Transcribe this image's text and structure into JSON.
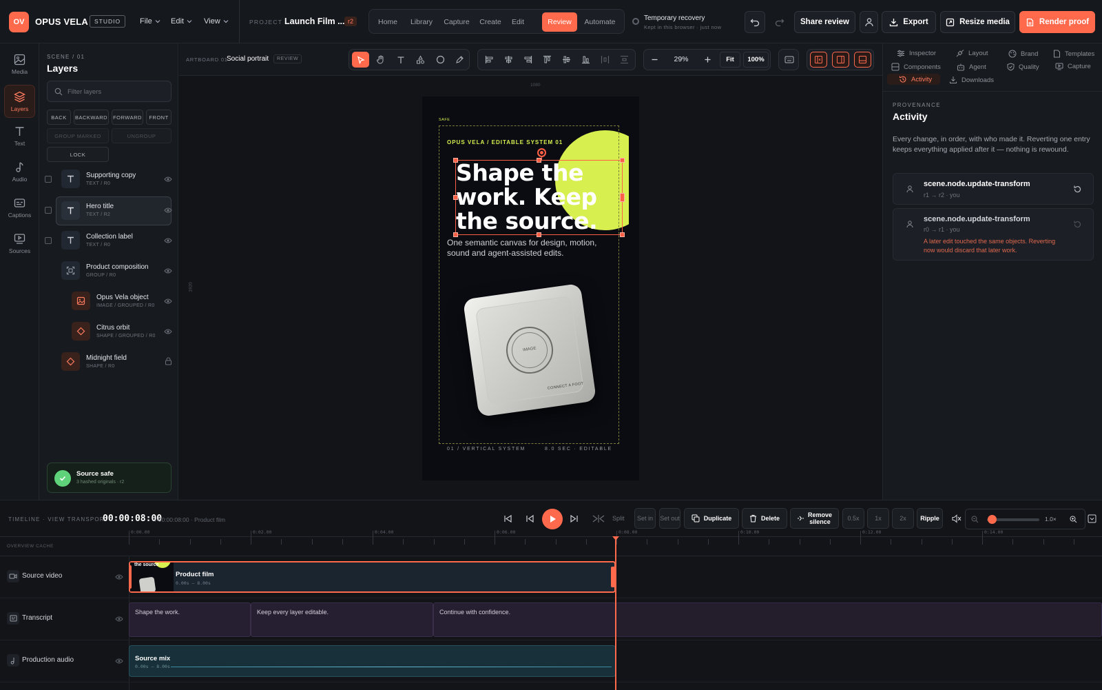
{
  "topbar": {
    "logo": "OV",
    "brand": "OPUS VELA",
    "studio": "STUDIO",
    "menus": [
      "File",
      "Edit",
      "View"
    ],
    "project_label": "PROJECT",
    "project_name": "Launch Film ...",
    "revision": "r2",
    "nav": [
      "Home",
      "Library",
      "Capture",
      "Create",
      "Edit",
      "Review",
      "Automate"
    ],
    "nav_active": "Review",
    "recovery_title": "Temporary recovery",
    "recovery_sub": "Kept in this browser · just now",
    "share": "Share review",
    "export": "Export",
    "resize": "Resize media",
    "render": "Render proof",
    "accent": "#ff6a4d"
  },
  "rail": [
    {
      "label": "Media",
      "icon": "image-icon"
    },
    {
      "label": "Layers",
      "icon": "layers-icon"
    },
    {
      "label": "Text",
      "icon": "text-icon"
    },
    {
      "label": "Audio",
      "icon": "music-note-icon"
    },
    {
      "label": "Captions",
      "icon": "captions-icon"
    },
    {
      "label": "Sources",
      "icon": "sources-icon"
    }
  ],
  "layers_panel": {
    "scene_label": "SCENE / 01",
    "title": "Layers",
    "filter_placeholder": "Filter layers",
    "order_buttons": [
      "BACK",
      "BACKWARD",
      "FORWARD",
      "FRONT"
    ],
    "group_buttons": [
      "GROUP MARKED",
      "UNGROUP"
    ],
    "lock_button": "LOCK",
    "items": [
      {
        "name": "Supporting copy",
        "sub": "TEXT / R0",
        "kind": "text"
      },
      {
        "name": "Hero title",
        "sub": "TEXT / R2",
        "kind": "text"
      },
      {
        "name": "Collection label",
        "sub": "TEXT / R0",
        "kind": "text"
      },
      {
        "name": "Product composition",
        "sub": "GROUP / R0",
        "kind": "group"
      },
      {
        "name": "Opus Vela object",
        "sub": "IMAGE / GROUPED / R0",
        "kind": "image"
      },
      {
        "name": "Citrus orbit",
        "sub": "SHAPE / GROUPED / R0",
        "kind": "shape"
      },
      {
        "name": "Midnight field",
        "sub": "SHAPE / R0",
        "kind": "shape"
      }
    ],
    "safe_title": "Source safe",
    "safe_sub": "3 hashed originals · r2"
  },
  "canvas": {
    "artboard_label": "ARTBOARD 01",
    "artboard_name": "Social portrait",
    "artboard_state": "REVIEW",
    "zoom": "29%",
    "fit": "Fit",
    "hundred": "100%",
    "ruler_top": "1080",
    "ruler_left": "1920",
    "safe": "SAFE",
    "kicker": "OPUS VELA / EDITABLE SYSTEM 01",
    "hero_title": "Shape the work. Keep the source.",
    "body_copy": "One semantic canvas for design, motion, sound and agent-assisted edits.",
    "image_label": "IMAGE",
    "image_caption": "CONNECT A FOOT",
    "footer_left": "01 / VERTICAL SYSTEM",
    "footer_right": "8.0 SEC · EDITABLE",
    "citrus_color": "#d7ef4f"
  },
  "right_panel": {
    "tabs": [
      {
        "label": "Inspector",
        "icon": "sliders-icon"
      },
      {
        "label": "Layout",
        "icon": "layout-icon"
      },
      {
        "label": "Brand",
        "icon": "palette-icon"
      },
      {
        "label": "Templates",
        "icon": "template-icon"
      },
      {
        "label": "Components",
        "icon": "components-icon"
      },
      {
        "label": "Agent",
        "icon": "robot-icon"
      },
      {
        "label": "Quality",
        "icon": "shield-icon"
      },
      {
        "label": "Capture",
        "icon": "capture-icon"
      },
      {
        "label": "Activity",
        "icon": "history-icon"
      },
      {
        "label": "Downloads",
        "icon": "download-icon"
      }
    ],
    "active_tab": "Activity",
    "section_label": "PROVENANCE",
    "title": "Activity",
    "description": "Every change, in order, with who made it. Reverting one entry keeps everything applied after it — nothing is rewound.",
    "entries": [
      {
        "action": "scene.node.update-transform",
        "meta": "r1 → r2 · you",
        "warning": ""
      },
      {
        "action": "scene.node.update-transform",
        "meta": "r0 → r1 · you",
        "warning": "A later edit touched the same objects. Reverting now would discard that later work."
      }
    ]
  },
  "timeline": {
    "label": "TIMELINE · VIEW TRANSPORT",
    "timecode": "00:00:08:00",
    "duration": "/ 00:00:08:00 · Product film",
    "buttons": {
      "split": "Split",
      "set_in": "Set in",
      "set_out": "Set out",
      "duplicate": "Duplicate",
      "delete": "Delete",
      "remove_silence": "Remove silence",
      "half": "0.5x",
      "one": "1x",
      "two": "2x",
      "ripple": "Ripple"
    },
    "zoom_value": "1.0×",
    "zoom_fraction": 0.05,
    "overview": "OVERVIEW CACHE",
    "ruler": [
      "0:00.00",
      "0:02.00",
      "0:04.00",
      "0:06.00",
      "0:08.00",
      "0:10.00",
      "0:12.00",
      "0:14.00"
    ],
    "tracks": [
      {
        "name": "Source video",
        "icon": "video-icon"
      },
      {
        "name": "Transcript",
        "icon": "captions-icon"
      },
      {
        "name": "Production audio",
        "icon": "music-note-icon"
      }
    ],
    "video_clip": {
      "title": "Product film",
      "range": "0.00s – 8.00s",
      "thumb_text": "the source"
    },
    "captions": [
      "Shape the work.",
      "Keep every layer editable.",
      "Continue with confidence."
    ],
    "audio_clip": {
      "title": "Source mix",
      "range": "0.00s – 8.00s"
    }
  }
}
